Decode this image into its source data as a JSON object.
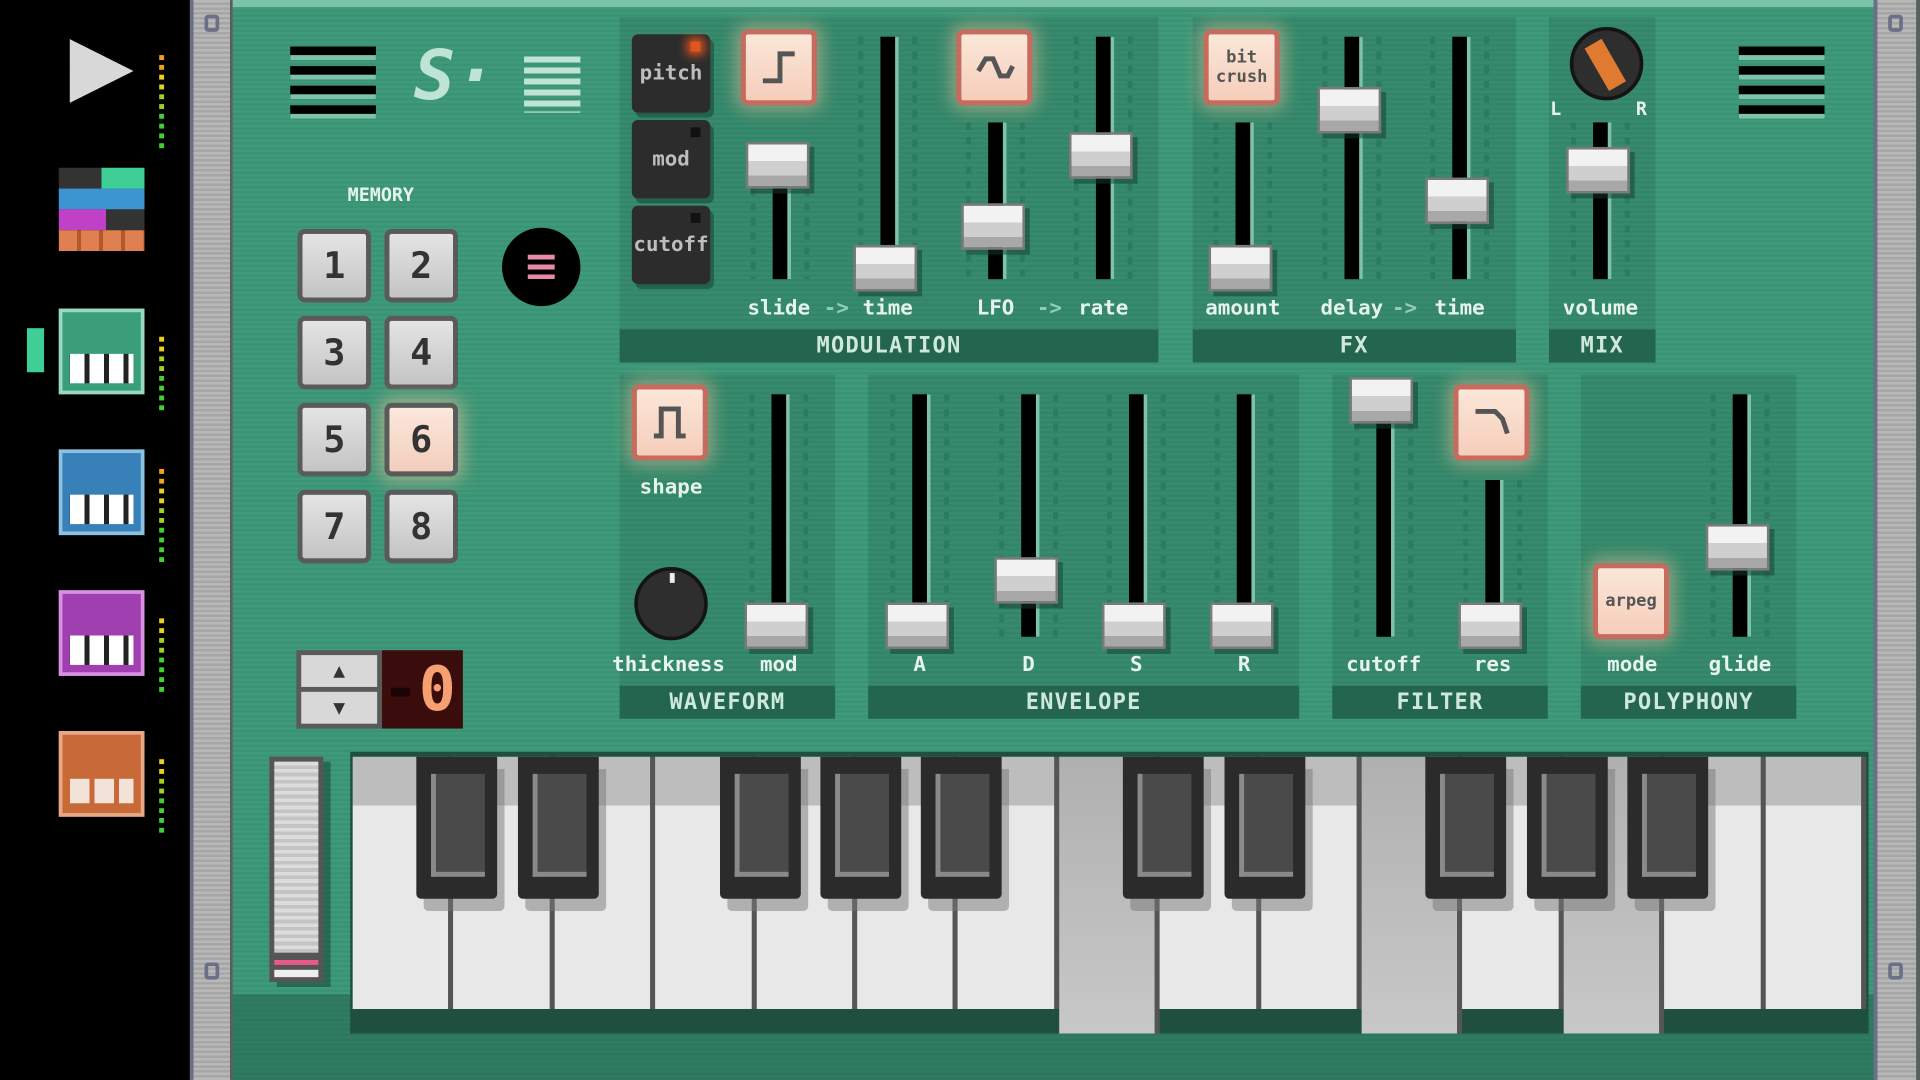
{
  "colors": {
    "panel": "#3f9a7a",
    "section_label": "#24654f",
    "button_lit": "#f6cdbb",
    "display_bg": "#3a0c0c",
    "display_digit": "#f4a070",
    "pitch_led": "#e0561e"
  },
  "sidebar": {
    "items": [
      {
        "icon": "play-icon"
      },
      {
        "icon": "song-arranger-icon"
      },
      {
        "icon": "synth-green-icon",
        "active": true
      },
      {
        "icon": "synth-blue-icon"
      },
      {
        "icon": "synth-purple-icon"
      },
      {
        "icon": "drum-orange-icon"
      }
    ]
  },
  "header": {
    "logo": "S·"
  },
  "memory": {
    "title": "MEMORY",
    "slots": [
      "1",
      "2",
      "3",
      "4",
      "5",
      "6",
      "7",
      "8"
    ],
    "selected": "6"
  },
  "octave": {
    "value": "0"
  },
  "modulation": {
    "title": "MODULATION",
    "targets": [
      "pitch",
      "mod",
      "cutoff"
    ],
    "active_target": "pitch",
    "slide_label": "slide",
    "time_label": "time",
    "lfo_label": "LFO",
    "rate_label": "rate",
    "arrow": "->"
  },
  "fx": {
    "title": "FX",
    "bitcrush_label": "bit crush",
    "amount_label": "amount",
    "delay_label": "delay",
    "time_label": "time",
    "arrow": "->"
  },
  "mix": {
    "title": "MIX",
    "volume_label": "volume",
    "pan_left": "L",
    "pan_right": "R"
  },
  "waveform": {
    "title": "WAVEFORM",
    "shape_label": "shape",
    "thickness_label": "thickness",
    "mod_label": "mod"
  },
  "envelope": {
    "title": "ENVELOPE",
    "a": "A",
    "d": "D",
    "s": "S",
    "r": "R"
  },
  "filter": {
    "title": "FILTER",
    "cutoff_label": "cutoff",
    "res_label": "res"
  },
  "polyphony": {
    "title": "POLYPHONY",
    "arpeg_label": "arpeg",
    "mode_label": "mode",
    "glide_label": "glide"
  },
  "sliders": {
    "slide": 1.0,
    "mod_time": 0.0,
    "lfo": 0.3,
    "lfo_rate": 0.5,
    "bitcrush_amount": 0.0,
    "delay": 0.7,
    "delay_time": 0.3,
    "volume": 0.7,
    "wave_mod": 0.0,
    "env_a": 0.0,
    "env_d": 0.2,
    "env_s": 0.0,
    "env_r": 0.0,
    "cutoff": 1.0,
    "res": 0.0,
    "glide": 0.35
  },
  "keyboard": {
    "white_keys": 15,
    "pressed_white": [
      7,
      10,
      12
    ]
  }
}
